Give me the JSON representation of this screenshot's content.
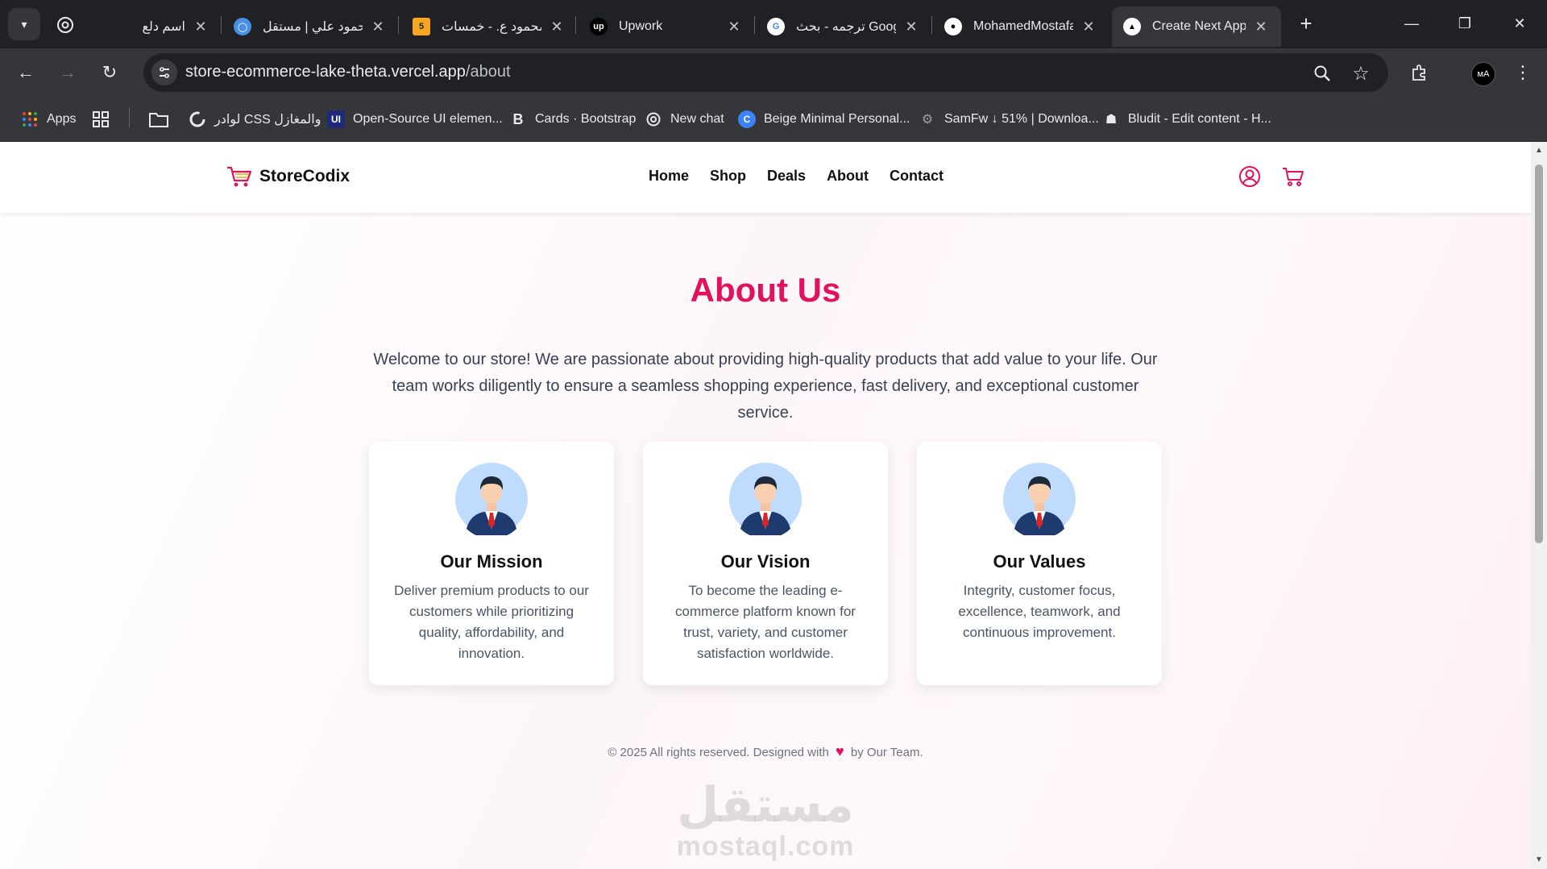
{
  "browser": {
    "tabs": [
      {
        "title": "اسم دلع",
        "active": false
      },
      {
        "title": "محمود علي | مستقل",
        "active": false
      },
      {
        "title": "محمود ع. - خمسات",
        "active": false
      },
      {
        "title": "Upwork",
        "active": false
      },
      {
        "title": "ترجمه - بحث Google",
        "active": false
      },
      {
        "title": "MohamedMostafa",
        "active": false
      },
      {
        "title": "Create Next App",
        "active": true
      }
    ],
    "url_host": "store-ecommerce-lake-theta.vercel.app",
    "url_path": "/about",
    "profile_initials": "ᴍA",
    "bookmarks": [
      {
        "label": "Apps"
      },
      {
        "label": "لوادر CSS والمغازل"
      },
      {
        "label": "Open-Source UI elemen..."
      },
      {
        "label": "Cards · Bootstrap"
      },
      {
        "label": "New chat"
      },
      {
        "label": "Beige Minimal Personal..."
      },
      {
        "label": "SamFw ↓ 51% | Downloa..."
      },
      {
        "label": "Bludit - Edit content - H..."
      }
    ]
  },
  "site": {
    "brand": "StoreCodix",
    "nav": [
      "Home",
      "Shop",
      "Deals",
      "About",
      "Contact"
    ],
    "accent_color": "#e0115f",
    "title": "About Us",
    "intro": "Welcome to our store! We are passionate about providing high-quality products that add value to your life. Our team works diligently to ensure a seamless shopping experience, fast delivery, and exceptional customer service.",
    "cards": [
      {
        "title": "Our Mission",
        "text": "Deliver premium products to our customers while prioritizing quality, affordability, and innovation."
      },
      {
        "title": "Our Vision",
        "text": "To become the leading e-commerce platform known for trust, variety, and customer satisfaction worldwide."
      },
      {
        "title": "Our Values",
        "text": "Integrity, customer focus, excellence, teamwork, and continuous improvement."
      }
    ],
    "footer_before": "© 2025 All rights reserved. Designed with",
    "footer_after": "by Our Team.",
    "watermark_ar": "مستقل",
    "watermark_en": "mostaql.com"
  }
}
